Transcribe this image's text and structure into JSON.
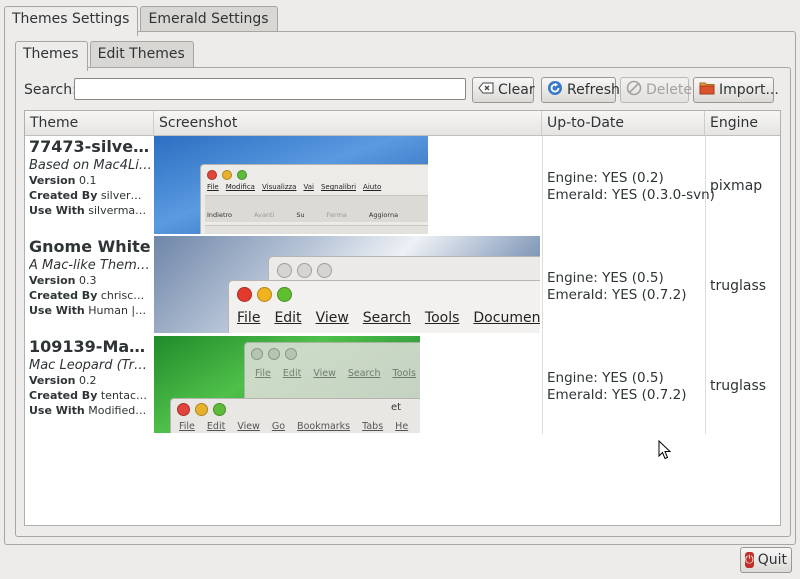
{
  "top_tabs": [
    "Themes Settings",
    "Emerald Settings"
  ],
  "inner_tabs": [
    "Themes",
    "Edit Themes"
  ],
  "search": {
    "label": "Search:",
    "value": ""
  },
  "buttons": {
    "clear": "Clear",
    "refresh": "Refresh",
    "delete": "Delete",
    "import": "Import...",
    "quit": "Quit"
  },
  "columns": [
    "Theme",
    "Screenshot",
    "Up-to-Date",
    "Engine"
  ],
  "themes": [
    {
      "title": "77473-silve…",
      "description": "Based on Mac4Li…",
      "version_label": "Version",
      "version": "0.1",
      "created_label": "Created By",
      "created": "silver…",
      "use_label": "Use With",
      "use": "silverma…",
      "engine_status": "Engine: YES (0.2)",
      "emerald_status": "Emerald: YES (0.3.0-svn)",
      "engine": "pixmap",
      "screenshot_menu": [
        "File",
        "Modifica",
        "Visualizza",
        "Vai",
        "Segnalibri",
        "Aiuto"
      ],
      "screenshot_toolbar": [
        "Indietro",
        "Avanti",
        "Su",
        "Ferma",
        "Aggiorna"
      ]
    },
    {
      "title": "Gnome White",
      "description": "A Mac-like Them…",
      "version_label": "Version",
      "version": "0.3",
      "created_label": "Created By",
      "created": "chrisc…",
      "use_label": "Use With",
      "use": "Human |…",
      "engine_status": "Engine: YES (0.5)",
      "emerald_status": "Emerald: YES (0.7.2)",
      "engine": "truglass",
      "screenshot_menu": [
        "File",
        "Edit",
        "View",
        "Search",
        "Tools",
        "Document"
      ]
    },
    {
      "title": "109139-Ma…",
      "description": "Mac Leopard (Tr…",
      "version_label": "Version",
      "version": "0.2",
      "created_label": "Created By",
      "created": "tentac…",
      "use_label": "Use With",
      "use": "Modified…",
      "engine_status": "Engine: YES (0.5)",
      "emerald_status": "Emerald: YES (0.7.2)",
      "engine": "truglass",
      "screenshot_menu_back": [
        "File",
        "Edit",
        "View",
        "Search",
        "Tools"
      ],
      "screenshot_menu": [
        "File",
        "Edit",
        "View",
        "Go",
        "Bookmarks",
        "Tabs",
        "He"
      ],
      "screenshot_title": "et"
    }
  ],
  "icons": {
    "clear": "clear-icon",
    "refresh": "refresh-icon",
    "delete": "delete-icon",
    "import": "import-icon",
    "quit": "power-icon",
    "cursor": "mouse-cursor-icon"
  }
}
